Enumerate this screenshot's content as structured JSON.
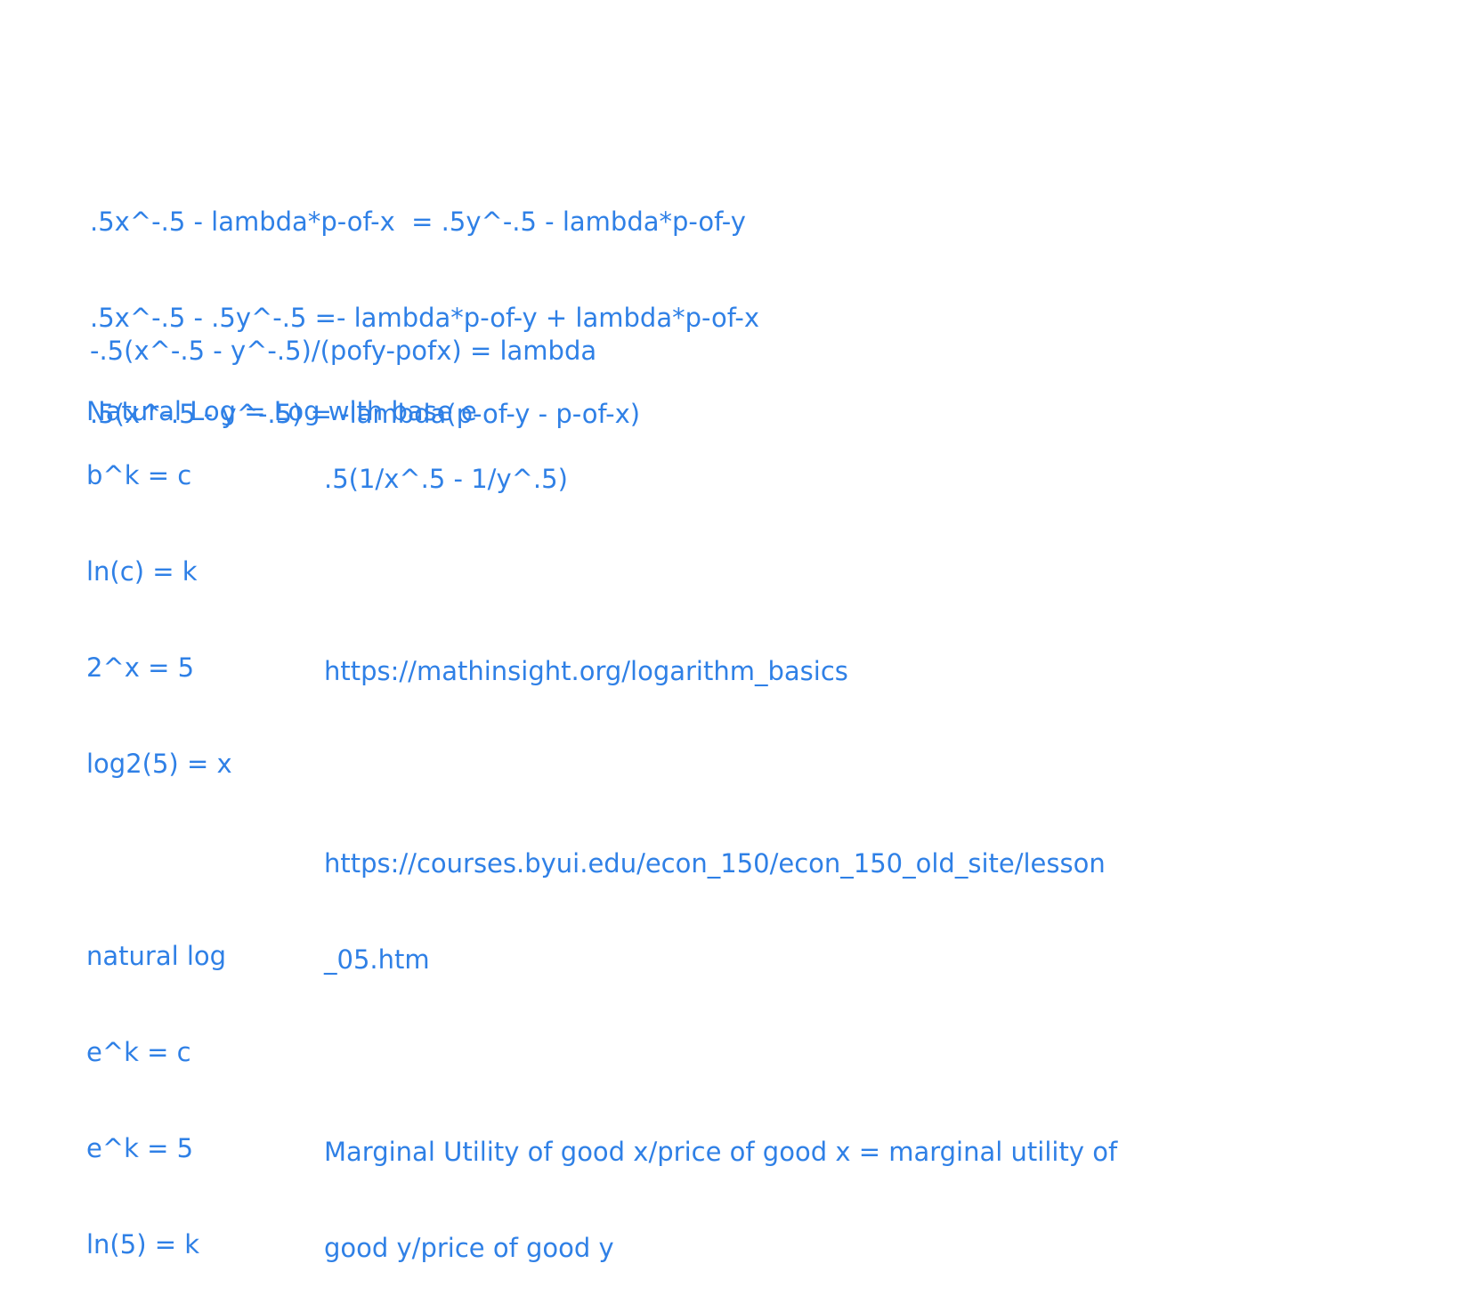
{
  "equations": [
    ".5x^-.5 - lambda*p-of-x  = .5y^-.5 - lambda*p-of-y",
    ".5x^-.5 - .5y^-.5 =- lambda*p-of-y + lambda*p-of-x",
    ".5(x^-.5 - y^-.5) = -lambda(p-of-y - p-of-x)"
  ],
  "lambda_solution": "-.5(x^-.5 - y^-.5)/(pofy-pofx) = lambda",
  "natural_log_definition": "Natural Log = Log with base e",
  "log_examples": [
    "b^k = c",
    "ln(c) = k",
    "2^x = 5",
    "log2(5) = x",
    "",
    "natural log",
    "e^k = c",
    "e^k = 5",
    "ln(5) = k"
  ],
  "notes": {
    "expression": ".5(1/x^.5 - 1/y^.5)",
    "link_1": "https://mathinsight.org/logarithm_basics",
    "link_2_line_1": "https://courses.byui.edu/econ_150/econ_150_old_site/lesson",
    "link_2_line_2": "_05.htm",
    "rule_line_1": "Marginal Utility of good x/price of good x = marginal utility of",
    "rule_line_2": "good y/price of good y"
  },
  "colors": {
    "text": "#2f80e6",
    "background": "#ffffff"
  }
}
